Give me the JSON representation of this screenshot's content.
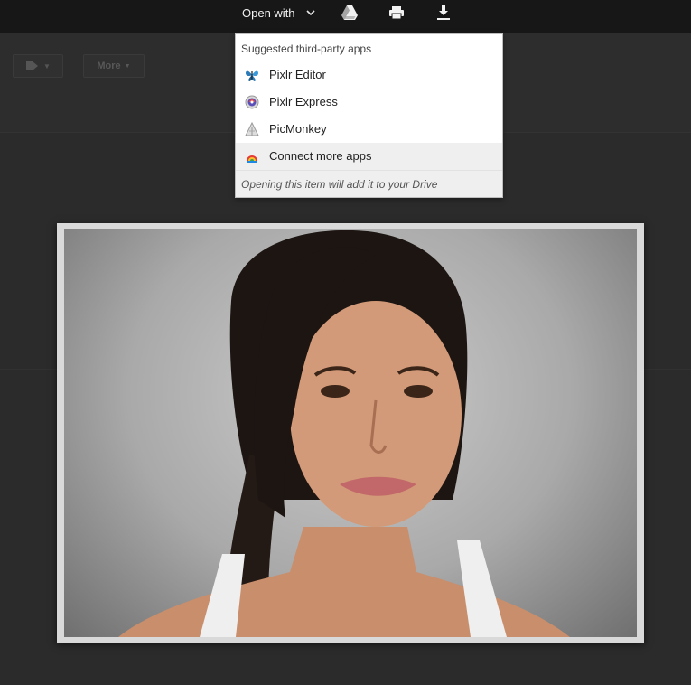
{
  "toolbar": {
    "open_with_label": "Open with",
    "icons": [
      "google-drive-icon",
      "print-icon",
      "download-icon"
    ]
  },
  "background": {
    "more_label": "More"
  },
  "menu": {
    "header": "Suggested third-party apps",
    "items": [
      {
        "label": "Pixlr Editor",
        "icon": "pixlr-editor-icon"
      },
      {
        "label": "Pixlr Express",
        "icon": "pixlr-express-icon"
      },
      {
        "label": "PicMonkey",
        "icon": "picmonkey-icon"
      },
      {
        "label": "Connect more apps",
        "icon": "connect-apps-icon"
      }
    ],
    "footer_note": "Opening this item will add it to your Drive"
  },
  "image": {
    "subject": "portrait-photo"
  },
  "colors": {
    "topbar": "#171717",
    "page_background": "#2b2b2b",
    "menu_background": "#ffffff",
    "menu_highlight": "#efefef"
  }
}
